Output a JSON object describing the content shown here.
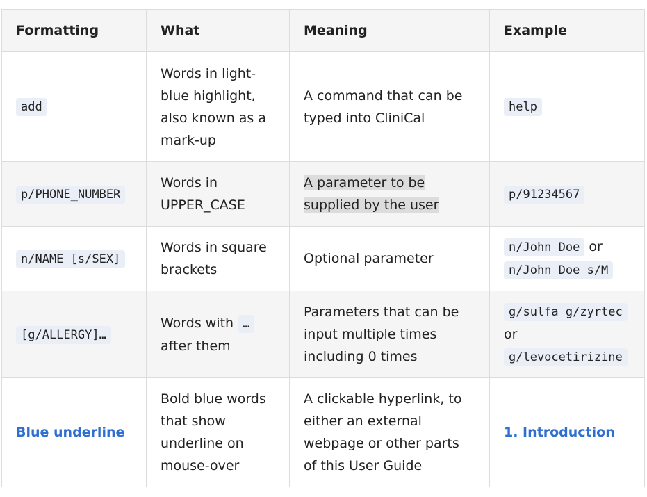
{
  "table": {
    "headers": [
      "Formatting",
      "What",
      "Meaning",
      "Example"
    ],
    "rows": [
      {
        "formatting": "add",
        "what": "Words in light-blue highlight, also known as a mark-up",
        "meaning": "A command that can be typed into CliniCal",
        "example": "help"
      },
      {
        "formatting": "p/PHONE_NUMBER",
        "what": "Words in UPPER_CASE",
        "meaning": "A parameter to be supplied by the user",
        "example": "p/91234567"
      },
      {
        "formatting": "n/NAME [s/SEX]",
        "what": "Words in square brackets",
        "meaning": "Optional parameter",
        "example_a": "n/John Doe",
        "example_sep": " or ",
        "example_b": "n/John Doe s/M"
      },
      {
        "formatting": "[g/ALLERGY]…",
        "what_before": "Words with ",
        "what_code": "…",
        "what_after": " after them",
        "meaning": "Parameters that can be input multiple times including 0 times",
        "example_a": "g/sulfa g/zyrtec",
        "example_sep": " or ",
        "example_b": "g/levocetirizine"
      },
      {
        "formatting": "Blue underline",
        "what": "Bold blue words that show underline on mouse-over",
        "meaning": "A clickable hyperlink, to either an external webpage or other parts of this User Guide",
        "example": "1. Introduction"
      }
    ]
  }
}
